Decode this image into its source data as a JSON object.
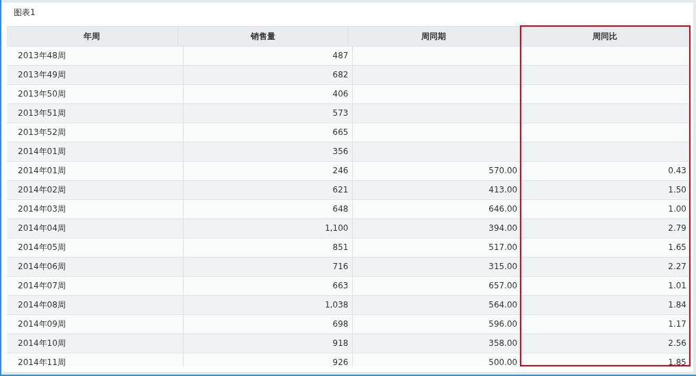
{
  "panel": {
    "title": "图表1"
  },
  "table": {
    "columns": [
      {
        "label": "年周",
        "highlighted": false
      },
      {
        "label": "销售量",
        "highlighted": false
      },
      {
        "label": "周同期",
        "highlighted": false
      },
      {
        "label": "周同比",
        "highlighted": true
      }
    ],
    "rows": [
      {
        "week": "2013年48周",
        "sales": "487"
      },
      {
        "week": "2013年49周",
        "sales": "682"
      },
      {
        "week": "2013年50周",
        "sales": "406"
      },
      {
        "week": "2013年51周",
        "sales": "573"
      },
      {
        "week": "2013年52周",
        "sales": "665"
      },
      {
        "week": "2014年01周",
        "sales": "356"
      },
      {
        "week": "2014年01周",
        "sales": "246",
        "same_period": "570.00",
        "ratio": "0.43"
      },
      {
        "week": "2014年02周",
        "sales": "621",
        "same_period": "413.00",
        "ratio": "1.50"
      },
      {
        "week": "2014年03周",
        "sales": "648",
        "same_period": "646.00",
        "ratio": "1.00"
      },
      {
        "week": "2014年04周",
        "sales": "1,100",
        "same_period": "394.00",
        "ratio": "2.79"
      },
      {
        "week": "2014年05周",
        "sales": "851",
        "same_period": "517.00",
        "ratio": "1.65"
      },
      {
        "week": "2014年06周",
        "sales": "716",
        "same_period": "315.00",
        "ratio": "2.27"
      },
      {
        "week": "2014年07周",
        "sales": "663",
        "same_period": "657.00",
        "ratio": "1.01"
      },
      {
        "week": "2014年08周",
        "sales": "1,038",
        "same_period": "564.00",
        "ratio": "1.84"
      },
      {
        "week": "2014年09周",
        "sales": "698",
        "same_period": "596.00",
        "ratio": "1.17"
      },
      {
        "week": "2014年10周",
        "sales": "918",
        "same_period": "358.00",
        "ratio": "2.56"
      },
      {
        "week": "2014年11周",
        "sales": "926",
        "same_period": "500.00",
        "ratio": "1.85"
      }
    ]
  }
}
